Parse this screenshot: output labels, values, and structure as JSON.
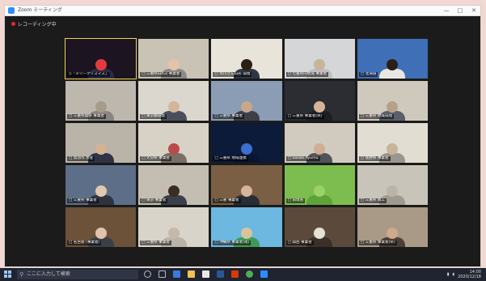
{
  "window": {
    "title": "Zoom ミーティング",
    "recording_label": "レコーディング中",
    "controls": [
      "—",
      "□",
      "✕"
    ]
  },
  "tiles": [
    {
      "name": "◇「メリークリスマス」",
      "bg": "#1c1420",
      "head": "#e33b3b",
      "body": "#2b2b4a",
      "active": true
    },
    {
      "name": "□ 三重県SDGs 事業者",
      "bg": "#c9c3b6",
      "head": "#e5c3a8",
      "body": "#8c8a86"
    },
    {
      "name": "□ 市川さん山形 環境",
      "bg": "#e8e4da",
      "head": "#2a2016",
      "body": "#2f3644"
    },
    {
      "name": "□ 七重県内地域 事業者",
      "bg": "#d4d6d8",
      "head": "#c7b59b",
      "body": "#bfbfbf"
    },
    {
      "name": "□ 北海道",
      "bg": "#3f6fb7",
      "head": "#2b1f18",
      "body": "#e9e7e2"
    },
    {
      "name": "□ 三重県関係 事業者",
      "bg": "#bdb7ad",
      "head": "#a89b8a",
      "body": "#8a8580"
    },
    {
      "name": "□ 東京都環境",
      "bg": "#dcd7ce",
      "head": "#d4b59c",
      "body": "#4a4e5c"
    },
    {
      "name": "□ 三重県 事業者",
      "bg": "#8a9db5",
      "head": "#c9a888",
      "body": "#3b3f4a"
    },
    {
      "name": "□ 三重県 事業者(県)",
      "bg": "#2b2d33",
      "head": "#d6b49a",
      "body": "#1d1e24"
    },
    {
      "name": "□ 三重県 地域環境",
      "bg": "#cfc9bd",
      "head": "#b7a08a",
      "body": "#5a5f6b"
    },
    {
      "name": "□ 鳥羽市 水産",
      "bg": "#b9b3a8",
      "head": "#d5b196",
      "body": "#2e3445"
    },
    {
      "name": "□ 大分県 事業者",
      "bg": "#d8d2c6",
      "head": "#b94b4b",
      "body": "#7a6f64"
    },
    {
      "name": "□ 三重県 地域連携",
      "bg": "#0d1b3a",
      "head": "#3b6fd1",
      "body": "#0b1430"
    },
    {
      "name": "□ Sasaki Ayumu",
      "bg": "#d1cbbf",
      "head": "#cfae92",
      "body": "#52535a"
    },
    {
      "name": "□ 長野県 事業者",
      "bg": "#e2ddd2",
      "head": "#c8b39c",
      "body": "#9a968e"
    },
    {
      "name": "□ 三重県 事業者",
      "bg": "#5d6f88",
      "head": "#e2c6ad",
      "body": "#2e3340"
    },
    {
      "name": "□ 東京 事業者",
      "bg": "#c4beb2",
      "head": "#3a2d22",
      "body": "#3b3f4a"
    },
    {
      "name": "□ 三重 事業者",
      "bg": "#7a5f45",
      "head": "#d5b49a",
      "body": "#2a2d36"
    },
    {
      "name": "□ 環境省",
      "bg": "#7dbd4f",
      "head": "#9bd26a",
      "body": "#5ea33a"
    },
    {
      "name": "□ 三重県 商工",
      "bg": "#c9c4ba",
      "head": "#b9b3a8",
      "body": "#9f998e"
    },
    {
      "name": "□ 名古屋 (事業者)",
      "bg": "#6b5238",
      "head": "#e0c3aa",
      "body": "#3b3f4a"
    },
    {
      "name": "□ 三重県 事業者",
      "bg": "#d9d4ca",
      "head": "#c6b9aa",
      "body": "#b8b2a7"
    },
    {
      "name": "□ 沖縄県 事業者(南)",
      "bg": "#6cb8e0",
      "head": "#d8c49c",
      "body": "#3f9a55"
    },
    {
      "name": "□ 関西 事業者",
      "bg": "#5b4a3c",
      "head": "#e6e1d8",
      "body": "#3a3028"
    },
    {
      "name": "□ 三重県 事業者(県)",
      "bg": "#a89a86",
      "head": "#cfa98a",
      "body": "#4a3f36"
    }
  ],
  "taskbar": {
    "search_placeholder": "ここに入力して検索",
    "clock_time": "14:00",
    "clock_date": "2020/12/18"
  }
}
